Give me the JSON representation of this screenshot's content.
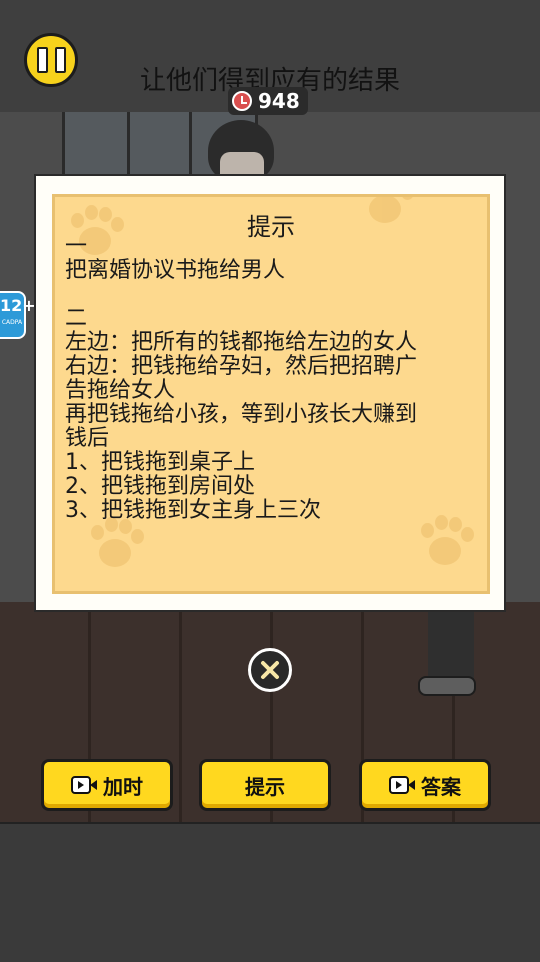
{
  "header": {
    "level_title": "让他们得到应有的结果",
    "coins": "948"
  },
  "age_rating": {
    "label": "12+",
    "sub": "CADPA"
  },
  "hint_dialog": {
    "title": "提示",
    "lines": [
      "一",
      "把离婚协议书拖给男人",
      "",
      "二",
      "左边：把所有的钱都拖给左边的女人",
      "右边：把钱拖给孕妇，然后把招聘广",
      "告拖给女人",
      "再把钱拖给小孩，等到小孩长大赚到",
      "钱后",
      "1、把钱拖到桌子上",
      "2、把钱拖到房间处",
      "3、把钱拖到女主身上三次"
    ]
  },
  "buttons": {
    "add_time": "加时",
    "hint": "提示",
    "answer": "答案"
  },
  "colors": {
    "accent_yellow": "#ffd81f",
    "paper": "#fdd98e",
    "background": "#3a3a3a"
  },
  "icons": {
    "pause": "pause-icon",
    "coin": "clock-coin-icon",
    "close": "close-icon",
    "video": "video-ad-icon"
  }
}
